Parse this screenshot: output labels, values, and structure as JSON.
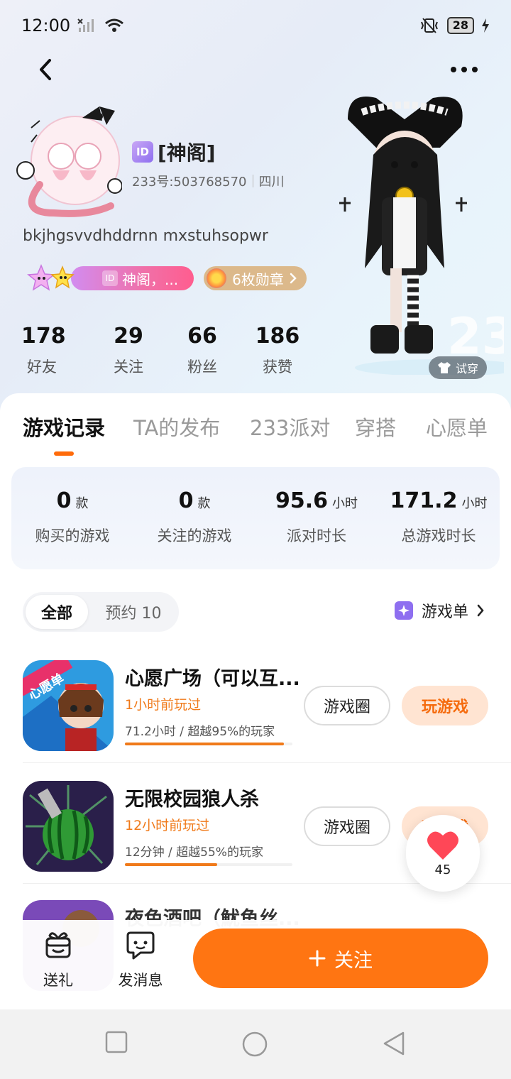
{
  "status_bar": {
    "time": "12:00",
    "battery": "28"
  },
  "profile": {
    "name": "[神阁]",
    "id_chip": "ID",
    "user_id": "233号:503768570",
    "region": "四川",
    "bio": "bkjhgsvvdhddrnn mxstuhsopwr",
    "title_badge": "神阁，...",
    "title_badge_chip": "ID",
    "medals": "6枚勋章",
    "try_on": "试穿"
  },
  "stats": [
    {
      "value": "178",
      "label": "好友"
    },
    {
      "value": "29",
      "label": "关注"
    },
    {
      "value": "66",
      "label": "粉丝"
    },
    {
      "value": "186",
      "label": "获赞"
    }
  ],
  "tabs": [
    "游戏记录",
    "TA的发布",
    "233派对",
    "穿搭",
    "心愿单"
  ],
  "summary": [
    {
      "value": "0",
      "unit": "款",
      "label": "购买的游戏"
    },
    {
      "value": "0",
      "unit": "款",
      "label": "关注的游戏"
    },
    {
      "value": "95.6",
      "unit": "小时",
      "label": "派对时长"
    },
    {
      "value": "171.2",
      "unit": "小时",
      "label": "总游戏时长"
    }
  ],
  "filter": {
    "all": "全部",
    "reserved": "预约 10",
    "game_list": "游戏单"
  },
  "games": [
    {
      "title": "心愿广场（可以互...",
      "played": "1小时前玩过",
      "stat": "71.2小时 / 超越95%的玩家",
      "progress": 0.95,
      "circle": "游戏圈",
      "play": "玩游戏",
      "icon_text": "心愿单"
    },
    {
      "title": "无限校园狼人杀",
      "played": "12小时前玩过",
      "stat": "12分钟 / 超越55%的玩家",
      "progress": 0.55,
      "circle": "游戏圈",
      "play": "玩游戏"
    },
    {
      "title": "夜色酒吧（魷鱼丝..."
    }
  ],
  "like_count": "45",
  "actions": {
    "gift": "送礼",
    "message": "发消息",
    "follow": "关注"
  },
  "colors": {
    "accent": "#ff7512",
    "tab_indicator": "#ff6b0a",
    "played_text": "#f07a1a"
  }
}
